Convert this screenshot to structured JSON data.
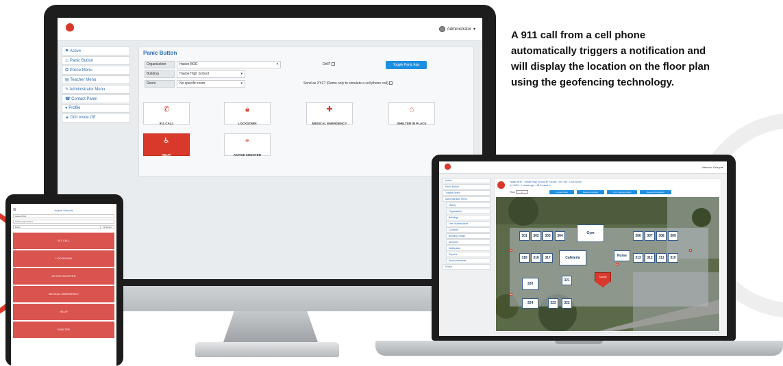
{
  "headline": {
    "lines": [
      "A 911 call from a cell phone",
      "automatically triggers a notification and",
      "will display the location on the floor plan",
      "using the geofencing technology."
    ]
  },
  "desktop": {
    "user_menu": "Administrator",
    "sidebar": [
      "Active",
      "Panic Button",
      "Police Menu",
      "Teacher Menu",
      "Administrator Menu",
      "Contact Panel",
      "Profile",
      "Drill mode Off"
    ],
    "panel_title": "Panic Button",
    "org_label": "Organization",
    "org_value": "Hasbe BOE",
    "building_label": "Building",
    "building_value": "Hasbe High School",
    "room_label": "Room",
    "room_value": "No specific room",
    "drill_label": "Drill?",
    "toggle_button": "Toggle Panic App",
    "xyz_label": "Send as XYZ? (Demo only to simulate a cell phone call)",
    "tiles": [
      "911 CALL",
      "LOCKDOWN",
      "MEDICAL EMERGENCY",
      "SHELTER IN PLACE",
      "HELP!",
      "ACTIVE SHOOTER"
    ],
    "colors": {
      "accent": "#d8392b",
      "link": "#2b6cb0",
      "button": "#1d8fe0"
    }
  },
  "laptop": {
    "user_menu": "Intersolv Group",
    "sidebar": [
      "Active",
      "Panic Button",
      "Teacher Menu",
      "Administration Menu",
      "History",
      "Organization",
      "Buildings",
      "User Maintenance",
      "Contacts",
      "Building Design",
      "Students",
      "Notification",
      "Reports",
      "Announcements",
      "Profile"
    ],
    "header_line1": "Hasbe BOE - Hasbe High School @ Faculty - Ext. 915 - Lock Down",
    "header_line2": "(c) 1992 - 1 minute ago - 45 Contact in",
    "floor_label": "Floor",
    "floor_value": "1",
    "buttons": [
      "Contact Back",
      "Request Contact",
      "Turn Campus Down",
      "Resend Notification"
    ],
    "rooms": [
      "301",
      "302",
      "303",
      "304",
      "Gym",
      "306",
      "307",
      "308",
      "309",
      "318",
      "316",
      "317",
      "Cafeteria",
      "Nurse",
      "313",
      "312",
      "311",
      "310",
      "Faculty",
      "320",
      "321",
      "324",
      "323",
      "322"
    ]
  },
  "tablet": {
    "title": "Hasbe Schools",
    "fields": [
      "Hasbe BOE",
      "Hasbe High School",
      "Room"
    ],
    "field_button": "No Room",
    "buttons": [
      "911 CALL",
      "LOCKDOWN",
      "ACTIVE SHOOTER",
      "MEDICAL EMERGENCY",
      "HELP!",
      "SHELTER"
    ]
  }
}
